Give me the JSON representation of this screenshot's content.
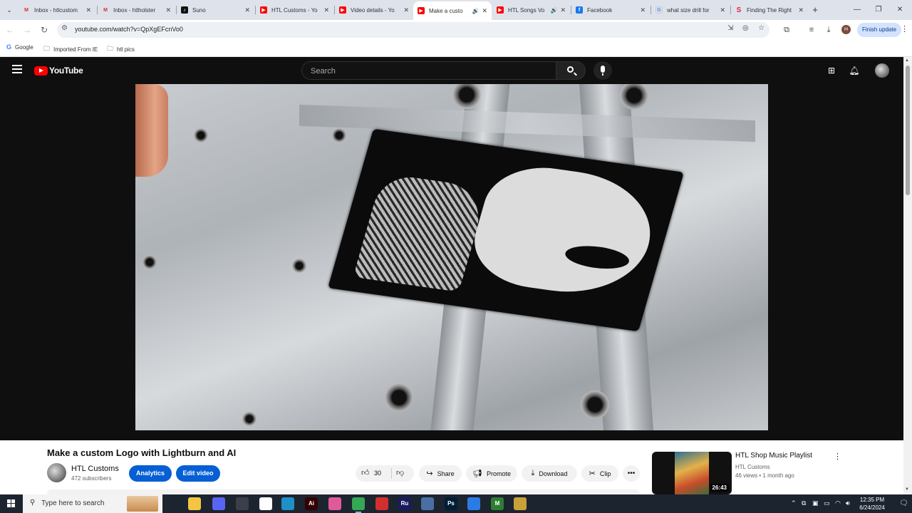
{
  "browser": {
    "tabs": [
      {
        "title": "Inbox - htlcustom",
        "icon": "gmail-icon",
        "active": false
      },
      {
        "title": "Inbox - htlholster",
        "icon": "gmail-icon",
        "active": false
      },
      {
        "title": "Suno",
        "icon": "suno-icon",
        "active": false
      },
      {
        "title": "HTL Customs - Yo",
        "icon": "youtube-icon",
        "active": false
      },
      {
        "title": "Video details - Yo",
        "icon": "youtube-icon",
        "active": false
      },
      {
        "title": "Make a custo",
        "icon": "youtube-icon",
        "active": true,
        "audio": true
      },
      {
        "title": "HTL Songs Vo",
        "icon": "youtube-icon",
        "active": false,
        "audio": true
      },
      {
        "title": "Facebook",
        "icon": "facebook-icon",
        "active": false
      },
      {
        "title": "what size drill for",
        "icon": "google-icon",
        "active": false
      },
      {
        "title": "Finding The Right",
        "icon": "s-icon",
        "active": false
      }
    ],
    "url": "youtube.com/watch?v=QpXgEFcnVo0",
    "profile_initial": "H",
    "finish_update_label": "Finish update",
    "bookmarks": [
      {
        "label": "Google",
        "icon": "google-icon"
      },
      {
        "label": "Imported From IE",
        "icon": "folder-icon"
      },
      {
        "label": "htl pics",
        "icon": "folder-icon"
      }
    ]
  },
  "youtube": {
    "logo_text": "YouTube",
    "search_placeholder": "Search",
    "video": {
      "title": "Make a custom Logo with Lightburn and AI",
      "channel_name": "HTL Customs",
      "subscribers": "472 subscribers",
      "analytics_label": "Analytics",
      "edit_label": "Edit video",
      "likes": "30",
      "share_label": "Share",
      "promote_label": "Promote",
      "download_label": "Download",
      "clip_label": "Clip"
    },
    "recommended": {
      "title": "HTL Shop Music Playlist",
      "channel": "HTL Customs",
      "views": "46 views",
      "age": "1 month ago",
      "duration": "26:43"
    }
  },
  "taskbar": {
    "search_placeholder": "Type here to search",
    "time": "12:35 PM",
    "date": "6/24/2024",
    "apps": [
      {
        "name": "task-view",
        "label": "",
        "color": "#1c2430"
      },
      {
        "name": "file-explorer",
        "label": "",
        "color": "#f5c542"
      },
      {
        "name": "discord",
        "label": "",
        "color": "#5865f2"
      },
      {
        "name": "calculator",
        "label": "",
        "color": "#3a3f4b"
      },
      {
        "name": "inkscape",
        "label": "",
        "color": "#ffffff"
      },
      {
        "name": "app-blue",
        "label": "",
        "color": "#1e90c8"
      },
      {
        "name": "illustrator",
        "label": "Ai",
        "color": "#330000"
      },
      {
        "name": "app-gradient",
        "label": "",
        "color": "#e05a9a"
      },
      {
        "name": "chrome",
        "label": "",
        "color": "#34a853"
      },
      {
        "name": "app-red",
        "label": "",
        "color": "#d32f2f"
      },
      {
        "name": "ru-app",
        "label": "Ru",
        "color": "#1a1a5e"
      },
      {
        "name": "app-doc",
        "label": "",
        "color": "#4a6fa5"
      },
      {
        "name": "photoshop",
        "label": "Ps",
        "color": "#001e36"
      },
      {
        "name": "app-board",
        "label": "",
        "color": "#2c7be5"
      },
      {
        "name": "app-m",
        "label": "M",
        "color": "#2e7d32"
      },
      {
        "name": "app-video",
        "label": "",
        "color": "#c8a13a"
      }
    ]
  }
}
